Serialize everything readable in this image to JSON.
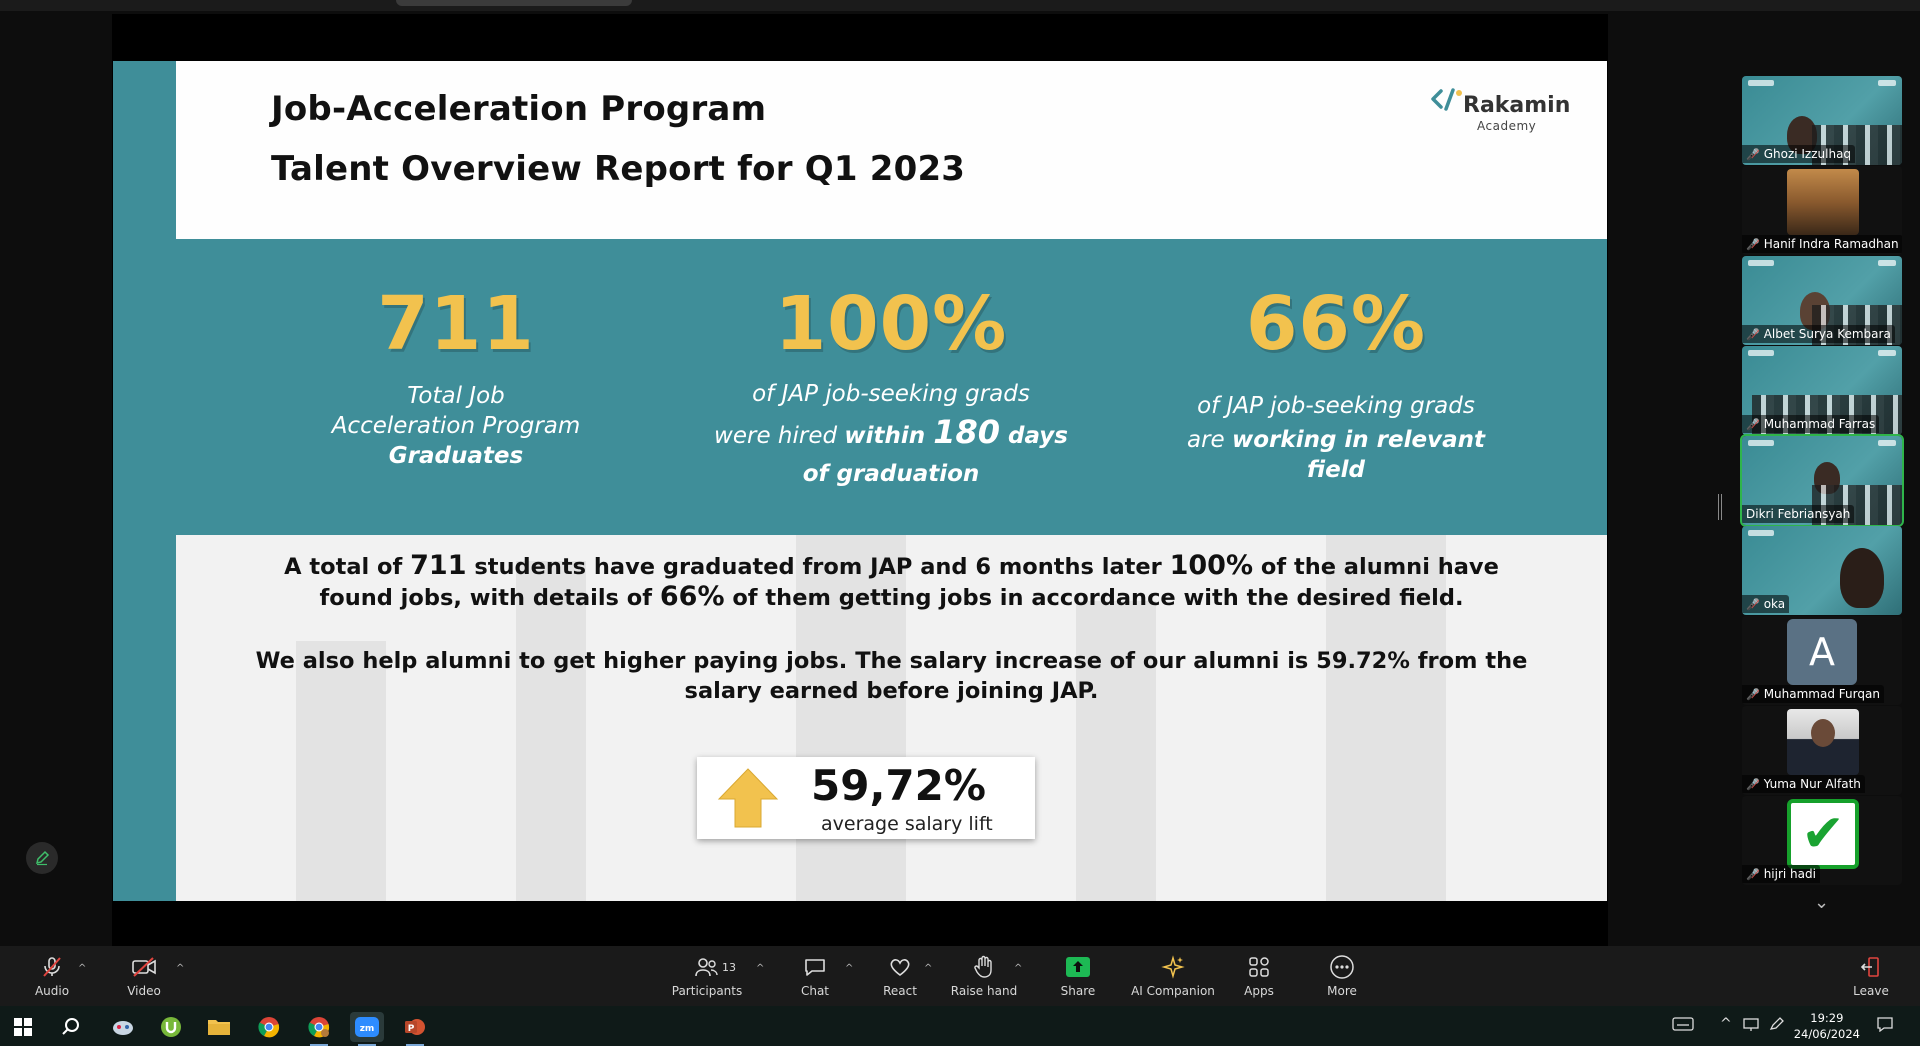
{
  "slide": {
    "title_line1": "Job-Acceleration Program",
    "title_line2": "Talent Overview Report for Q1 2023",
    "logo_name": "Rakamin",
    "logo_sub": "Academy",
    "stats": [
      {
        "value": "711",
        "desc_l1": "Total Job",
        "desc_l2": "Acceleration Program",
        "desc_l3": "Graduates"
      },
      {
        "value": "100%",
        "desc_l1": "of JAP job-seeking grads",
        "desc_l2a": "were hired ",
        "desc_l2b": "within ",
        "desc_l2c": "180",
        "desc_l2d": " days",
        "desc_l3": "of graduation"
      },
      {
        "value": "66%",
        "desc_l1": "of JAP job-seeking grads",
        "desc_l2a": "are ",
        "desc_l2b": "working in relevant",
        "desc_l3": "field"
      }
    ],
    "para1": {
      "p1": "A total of ",
      "n1": "711",
      "p2": " students have graduated from JAP and 6 months later ",
      "n2": "100%",
      "p3": " of the alumni have",
      "p4": "found jobs, with details of ",
      "n3": "66%",
      "p5": " of them getting jobs in accordance with the desired field."
    },
    "para2": {
      "line1": "We also help alumni to get higher paying jobs. The salary increase of our alumni is 59.72% from the",
      "line2": "salary earned before joining JAP."
    },
    "lift_value": "59,72%",
    "lift_label": "average salary lift"
  },
  "participants": [
    {
      "name": "Ghozi Izzulhaq",
      "type": "teal-video"
    },
    {
      "name": "Hanif Indra Ramadhan",
      "type": "photo"
    },
    {
      "name": "Albet Surya Kembara",
      "type": "teal-video"
    },
    {
      "name": "Muhammad Farras",
      "type": "teal-video"
    },
    {
      "name": "Dikri Febriansyah",
      "type": "teal-video",
      "active": true
    },
    {
      "name": "oka",
      "type": "teal-video"
    },
    {
      "name": "Muhammad Furqan",
      "type": "letter",
      "letter": "A"
    },
    {
      "name": "Yuma Nur Alfath",
      "type": "photo"
    },
    {
      "name": "hijri hadi",
      "type": "check"
    }
  ],
  "toolbar": {
    "audio": "Audio",
    "video": "Video",
    "participants": "Participants",
    "participants_count": "13",
    "chat": "Chat",
    "react": "React",
    "raise_hand": "Raise hand",
    "share": "Share",
    "ai_companion": "AI Companion",
    "apps": "Apps",
    "more": "More",
    "leave": "Leave"
  },
  "taskbar": {
    "time": "19:29",
    "date": "24/06/2024"
  },
  "colors": {
    "teal": "#3f8e99",
    "gold": "#f2c24e",
    "share_green": "#1db954",
    "leave_red": "#e0443e",
    "active_border": "#2fb54a"
  }
}
